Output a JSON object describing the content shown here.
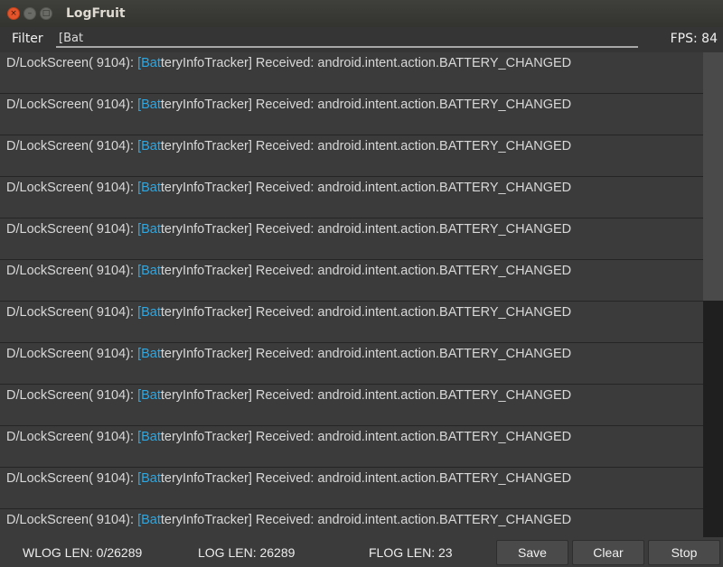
{
  "window": {
    "title": "LogFruit",
    "controls": {
      "close": "×",
      "minimize": "–",
      "maximize": "□"
    }
  },
  "filter": {
    "label": "Filter",
    "value": "[Bat",
    "fps": "FPS: 84"
  },
  "log": {
    "rows": [
      {
        "prefix": "D/LockScreen( 9104): ",
        "match": "[Bat",
        "rest": "teryInfoTracker] Received: android.intent.action.BATTERY_CHANGED"
      },
      {
        "prefix": "D/LockScreen( 9104): ",
        "match": "[Bat",
        "rest": "teryInfoTracker] Received: android.intent.action.BATTERY_CHANGED"
      },
      {
        "prefix": "D/LockScreen( 9104): ",
        "match": "[Bat",
        "rest": "teryInfoTracker] Received: android.intent.action.BATTERY_CHANGED"
      },
      {
        "prefix": "D/LockScreen( 9104): ",
        "match": "[Bat",
        "rest": "teryInfoTracker] Received: android.intent.action.BATTERY_CHANGED"
      },
      {
        "prefix": "D/LockScreen( 9104): ",
        "match": "[Bat",
        "rest": "teryInfoTracker] Received: android.intent.action.BATTERY_CHANGED"
      },
      {
        "prefix": "D/LockScreen( 9104): ",
        "match": "[Bat",
        "rest": "teryInfoTracker] Received: android.intent.action.BATTERY_CHANGED"
      },
      {
        "prefix": "D/LockScreen( 9104): ",
        "match": "[Bat",
        "rest": "teryInfoTracker] Received: android.intent.action.BATTERY_CHANGED"
      },
      {
        "prefix": "D/LockScreen( 9104): ",
        "match": "[Bat",
        "rest": "teryInfoTracker] Received: android.intent.action.BATTERY_CHANGED"
      },
      {
        "prefix": "D/LockScreen( 9104): ",
        "match": "[Bat",
        "rest": "teryInfoTracker] Received: android.intent.action.BATTERY_CHANGED"
      },
      {
        "prefix": "D/LockScreen( 9104): ",
        "match": "[Bat",
        "rest": "teryInfoTracker] Received: android.intent.action.BATTERY_CHANGED"
      },
      {
        "prefix": "D/LockScreen( 9104): ",
        "match": "[Bat",
        "rest": "teryInfoTracker] Received: android.intent.action.BATTERY_CHANGED"
      },
      {
        "prefix": "D/LockScreen( 9104): ",
        "match": "[Bat",
        "rest": "teryInfoTracker] Received: android.intent.action.BATTERY_CHANGED"
      }
    ],
    "highlight_color": "#2aa9e6"
  },
  "status": {
    "wlog": "WLOG LEN: 0/26289",
    "log": "LOG LEN: 26289",
    "flog": "FLOG LEN: 23",
    "save_label": "Save",
    "clear_label": "Clear",
    "stop_label": "Stop"
  }
}
